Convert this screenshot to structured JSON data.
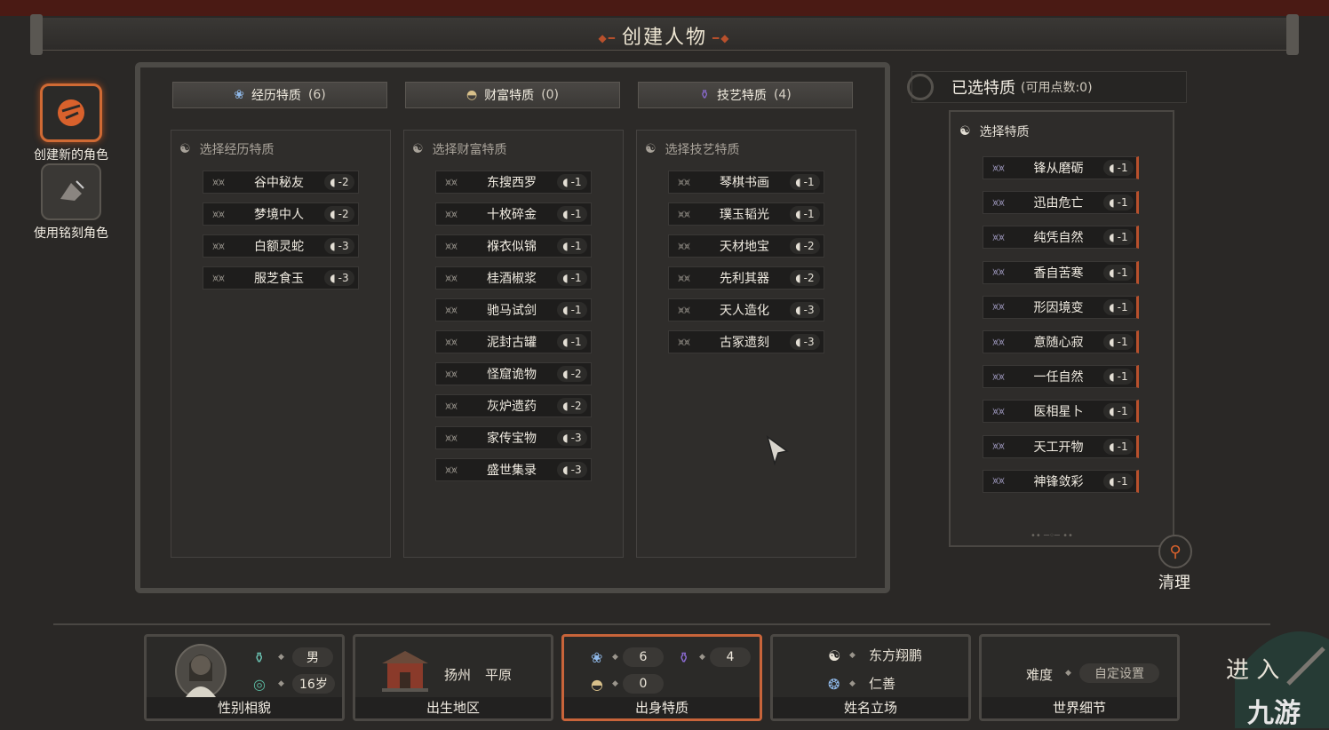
{
  "title": "创建人物",
  "left_menu": [
    {
      "label": "创建新的角色",
      "active": true,
      "icon": "mask-icon"
    },
    {
      "label": "使用铭刻角色",
      "active": false,
      "icon": "bird-scroll-icon"
    }
  ],
  "tabs": [
    {
      "label": "经历特质",
      "count": "(6)",
      "icon": "lotus-icon"
    },
    {
      "label": "财富特质",
      "count": "(0)",
      "icon": "ingot-icon"
    },
    {
      "label": "技艺特质",
      "count": "(4)",
      "icon": "vase-icon"
    }
  ],
  "columns": [
    {
      "header": "选择经历特质",
      "traits": [
        {
          "name": "谷中秘友",
          "cost": "-2"
        },
        {
          "name": "梦境中人",
          "cost": "-2"
        },
        {
          "name": "白额灵蛇",
          "cost": "-3"
        },
        {
          "name": "服芝食玉",
          "cost": "-3"
        }
      ]
    },
    {
      "header": "选择财富特质",
      "traits": [
        {
          "name": "东搜西罗",
          "cost": "-1"
        },
        {
          "name": "十枚碎金",
          "cost": "-1"
        },
        {
          "name": "褓衣似锦",
          "cost": "-1"
        },
        {
          "name": "桂酒椒浆",
          "cost": "-1"
        },
        {
          "name": "驰马试剑",
          "cost": "-1"
        },
        {
          "name": "泥封古罐",
          "cost": "-1"
        },
        {
          "name": "怪窟诡物",
          "cost": "-2"
        },
        {
          "name": "灰炉遗药",
          "cost": "-2"
        },
        {
          "name": "家传宝物",
          "cost": "-3"
        },
        {
          "name": "盛世集录",
          "cost": "-3"
        }
      ]
    },
    {
      "header": "选择技艺特质",
      "traits": [
        {
          "name": "琴棋书画",
          "cost": "-1"
        },
        {
          "name": "璞玉韬光",
          "cost": "-1"
        },
        {
          "name": "天材地宝",
          "cost": "-2"
        },
        {
          "name": "先利其器",
          "cost": "-2"
        },
        {
          "name": "天人造化",
          "cost": "-3"
        },
        {
          "name": "古冢遗刻",
          "cost": "-3"
        }
      ]
    }
  ],
  "selected": {
    "title": "已选特质",
    "points": "(可用点数:0)",
    "header": "选择特质",
    "traits": [
      {
        "name": "锋从磨砺",
        "cost": "-1"
      },
      {
        "name": "迅由危亡",
        "cost": "-1"
      },
      {
        "name": "纯凭自然",
        "cost": "-1"
      },
      {
        "name": "香自苦寒",
        "cost": "-1"
      },
      {
        "name": "形因境变",
        "cost": "-1"
      },
      {
        "name": "意随心寂",
        "cost": "-1"
      },
      {
        "name": "一任自然",
        "cost": "-1"
      },
      {
        "name": "医相星卜",
        "cost": "-1"
      },
      {
        "name": "天工开物",
        "cost": "-1"
      },
      {
        "name": "神锋敛彩",
        "cost": "-1"
      }
    ],
    "clear_label": "清理"
  },
  "bottom": {
    "appearance": {
      "label": "性别相貌",
      "gender": "男",
      "age": "16岁"
    },
    "birthplace": {
      "label": "出生地区",
      "city": "扬州",
      "terrain": "平原"
    },
    "origin": {
      "label": "出身特质",
      "experience": "6",
      "skill": "4",
      "wealth": "0"
    },
    "name": {
      "label": "姓名立场",
      "name": "东方翔鹏",
      "stance": "仁善"
    },
    "world": {
      "label": "世界细节",
      "difficulty_label": "难度",
      "difficulty_value": "自定设置"
    }
  },
  "enter_label": "进 入",
  "watermark": "九游",
  "colors": {
    "accent": "#c8643a",
    "panel": "#2c2a28",
    "text": "#f0ebe1"
  }
}
